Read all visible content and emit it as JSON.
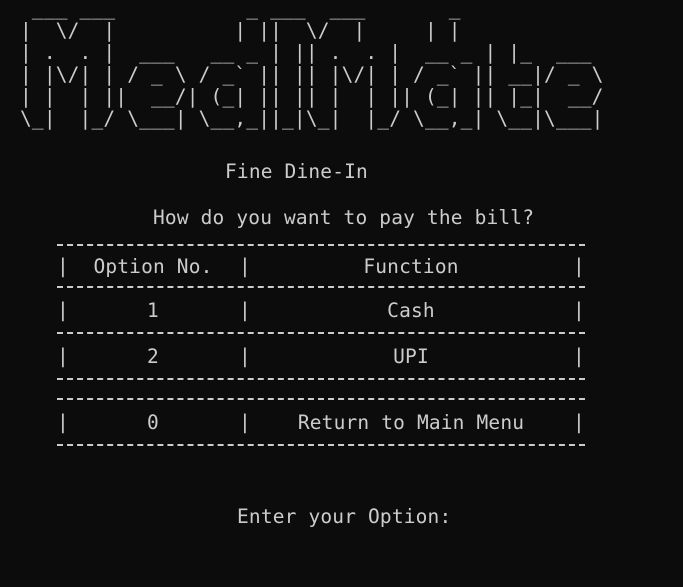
{
  "banner": {
    "ascii_art": " ___ ___           _ ___  ___       _\n|  \\/  |          | ||  \\/  |     | |\n| .  . |  ___   __ _ | || .  . |  __ _ | |_  ___\n| |\\/| | / _ \\ / _` || || |\\/| | / _` || __|/ _ \\\n| |  | ||  __/| (_| || || |  | || (_| || |_|  __/\n\\_|  |_/ \\___| \\__,_||_|\\_|  |_/ \\__,_| \\__|\\___|"
  },
  "subtitle": "Fine Dine-In",
  "question": "How do you want to pay the bill?",
  "table": {
    "header": {
      "option_no": "Option No.",
      "function": "Function"
    },
    "rows": [
      {
        "option": "1",
        "function": "Cash"
      },
      {
        "option": "2",
        "function": "UPI"
      },
      {
        "option": "0",
        "function": "Return to Main Menu"
      }
    ]
  },
  "prompt": "Enter your Option:"
}
